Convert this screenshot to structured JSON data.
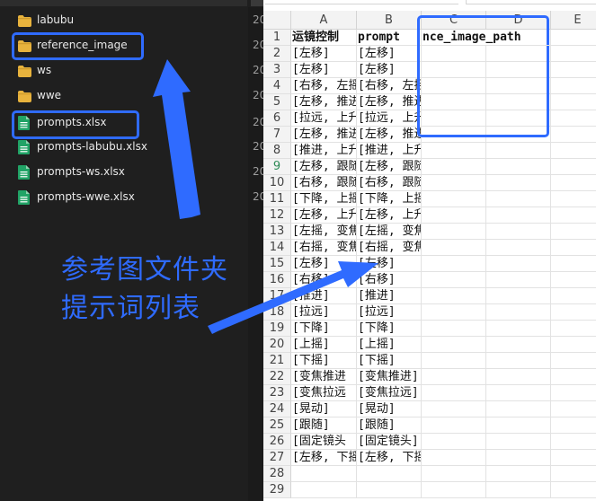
{
  "explorer": {
    "files": [
      {
        "name": "labubu",
        "type": "folder",
        "date": "20"
      },
      {
        "name": "reference_image",
        "type": "folder",
        "date": "20"
      },
      {
        "name": "ws",
        "type": "folder",
        "date": "20"
      },
      {
        "name": "wwe",
        "type": "folder",
        "date": "20"
      },
      {
        "name": "prompts.xlsx",
        "type": "excel",
        "date": "20"
      },
      {
        "name": "prompts-labubu.xlsx",
        "type": "excel",
        "date": "20"
      },
      {
        "name": "prompts-ws.xlsx",
        "type": "excel",
        "date": "20"
      },
      {
        "name": "prompts-wwe.xlsx",
        "type": "excel",
        "date": "20"
      }
    ],
    "colors": {
      "folder": "#e8b33d",
      "excel": "#21a366",
      "highlight": "#2f6bff"
    }
  },
  "annotations": {
    "line1": "参考图文件夹",
    "line2": "提示词列表"
  },
  "sheet": {
    "columns": [
      "A",
      "B",
      "C",
      "D",
      "E"
    ],
    "rows": [
      {
        "num": "1",
        "a": "运镜控制",
        "b": "prompt",
        "c": "reference_image_path",
        "c_visible": "nce_image_path",
        "d": ""
      },
      {
        "num": "2",
        "a": "[左移]",
        "b": "[左移]"
      },
      {
        "num": "3",
        "a": "[左移]",
        "b": "[左移]"
      },
      {
        "num": "4",
        "a": "[右移, 左摇",
        "b": "[右移, 左摇, 跟随]"
      },
      {
        "num": "5",
        "a": "[左移, 推进",
        "b": "[左移, 推进, 右摇]"
      },
      {
        "num": "6",
        "a": "[拉远, 上升",
        "b": "[拉远, 上升, 下摇]"
      },
      {
        "num": "7",
        "a": "[左移, 推进",
        "b": "[左移, 推进, 右摇]"
      },
      {
        "num": "8",
        "a": "[推进, 上升",
        "b": "[推进, 上升]"
      },
      {
        "num": "9",
        "a": "[左移, 跟随",
        "b": "[左移, 跟随]"
      },
      {
        "num": "10",
        "a": "[右移, 跟随",
        "b": "[右移, 跟随]"
      },
      {
        "num": "11",
        "a": "[下降, 上摇",
        "b": "[下降, 上摇]"
      },
      {
        "num": "12",
        "a": "[左移, 上升",
        "b": "[左移, 上升]"
      },
      {
        "num": "13",
        "a": "[左摇, 变焦",
        "b": "[左摇, 变焦推进]"
      },
      {
        "num": "14",
        "a": "[右摇, 变焦",
        "b": "[右摇, 变焦推进]"
      },
      {
        "num": "15",
        "a": "[左移]",
        "b": "[左移]"
      },
      {
        "num": "16",
        "a": "[右移]",
        "b": "[右移]"
      },
      {
        "num": "17",
        "a": "[推进]",
        "b": "[推进]"
      },
      {
        "num": "18",
        "a": "[拉远]",
        "b": "[拉远]"
      },
      {
        "num": "19",
        "a": "[下降]",
        "b": "[下降]"
      },
      {
        "num": "20",
        "a": "[上摇]",
        "b": "[上摇]"
      },
      {
        "num": "21",
        "a": "[下摇]",
        "b": "[下摇]"
      },
      {
        "num": "22",
        "a": "[变焦推进",
        "b": "[变焦推进]"
      },
      {
        "num": "23",
        "a": "[变焦拉远",
        "b": "[变焦拉远]"
      },
      {
        "num": "24",
        "a": "[晃动]",
        "b": "[晃动]"
      },
      {
        "num": "25",
        "a": "[跟随]",
        "b": "[跟随]"
      },
      {
        "num": "26",
        "a": "[固定镜头",
        "b": "[固定镜头]"
      },
      {
        "num": "27",
        "a": "[左移, 下摇",
        "b": "[左移, 下摇]"
      },
      {
        "num": "28",
        "a": "",
        "b": ""
      },
      {
        "num": "29",
        "a": "",
        "b": ""
      }
    ],
    "selected_row": "9"
  }
}
